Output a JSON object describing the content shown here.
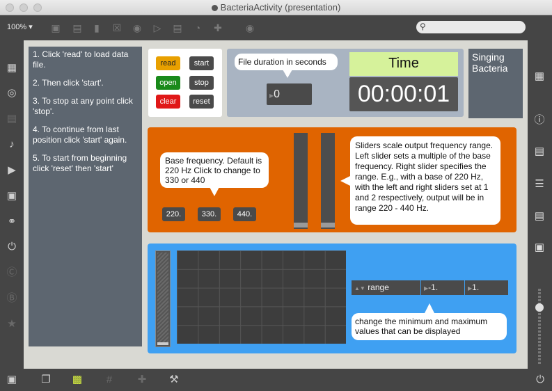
{
  "window": {
    "title": "BacteriaActivity (presentation)"
  },
  "toolbar": {
    "zoom": "100%"
  },
  "instructions": [
    "1. Click 'read' to load data file.",
    "2. Then click 'start'.",
    "3. To stop at any point click 'stop'.",
    "4. To continue from last position click 'start' again.",
    "5. To start from beginning click 'reset' then 'start'"
  ],
  "buttons": {
    "read": "read",
    "start": "start",
    "open": "open",
    "stop": "stop",
    "clear": "clear",
    "reset": "reset"
  },
  "file_panel": {
    "comment": "File duration in seconds",
    "value": "0"
  },
  "time": {
    "label": "Time",
    "value": "00:00:01"
  },
  "title_label": "Singing Bacteria",
  "frequency": {
    "comment": "Base frequency. Default is 220 Hz Click to change to 330 or 440",
    "options": [
      "220.",
      "330.",
      "440."
    ],
    "slider_comment": "Sliders scale output frequency range. Left slider sets a multiple of the base frequency. Right slider specifies the range. E.g., with a base of 220 Hz, with the left and right sliders set at 1 and 2 respectively, output will be in range 220 - 440 Hz.",
    "left_slider_level": 0.0,
    "right_slider_level": 0.0
  },
  "display": {
    "range_label": "range",
    "min": "-1.",
    "max": "1.",
    "comment": "change the minimum and maximum values that can be displayed"
  },
  "colors": {
    "read": "#e8a000",
    "start": "#4a4a4a",
    "open": "#1a8a1a",
    "stop": "#4a4a4a",
    "clear": "#e01818",
    "reset": "#4a4a4a",
    "orange_panel": "#e06400",
    "blue_panel": "#3fa0f2",
    "time_header": "#d6f29b"
  },
  "icons": {
    "left_sidebar": [
      "cube-icon",
      "target-icon",
      "keyboard-icon",
      "music-note-icon",
      "media-icon",
      "image-icon",
      "paperclip-icon",
      "plug-icon",
      "vizzie-icon",
      "beap-icon",
      "star-icon"
    ],
    "right_sidebar": [
      "grid-view-icon",
      "info-icon",
      "book-icon",
      "list-icon",
      "reference-icon",
      "camera-icon"
    ],
    "bottom_bar": [
      "lock-icon",
      "windows-icon",
      "presentation-icon",
      "grid-icon",
      "patch-cord-icon",
      "wrench-icon",
      "power-icon"
    ]
  }
}
